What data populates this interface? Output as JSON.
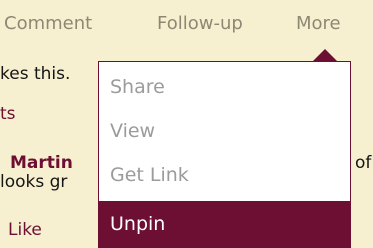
{
  "toolbar": {
    "items": [
      "Comment",
      "Follow-up",
      "More"
    ]
  },
  "background": {
    "likes": "kes this.",
    "section": "ts",
    "author": "Martin",
    "author_suffix": "of",
    "snippet": "looks gr",
    "like_link": "Like"
  },
  "menu": {
    "items": [
      {
        "label": "Share"
      },
      {
        "label": "View"
      },
      {
        "label": "Get Link"
      },
      {
        "label": "Unpin",
        "active": true
      }
    ]
  },
  "colors": {
    "accent": "#6d0f33",
    "background": "#f7f0d0",
    "menu_text": "#9b9b9b"
  }
}
